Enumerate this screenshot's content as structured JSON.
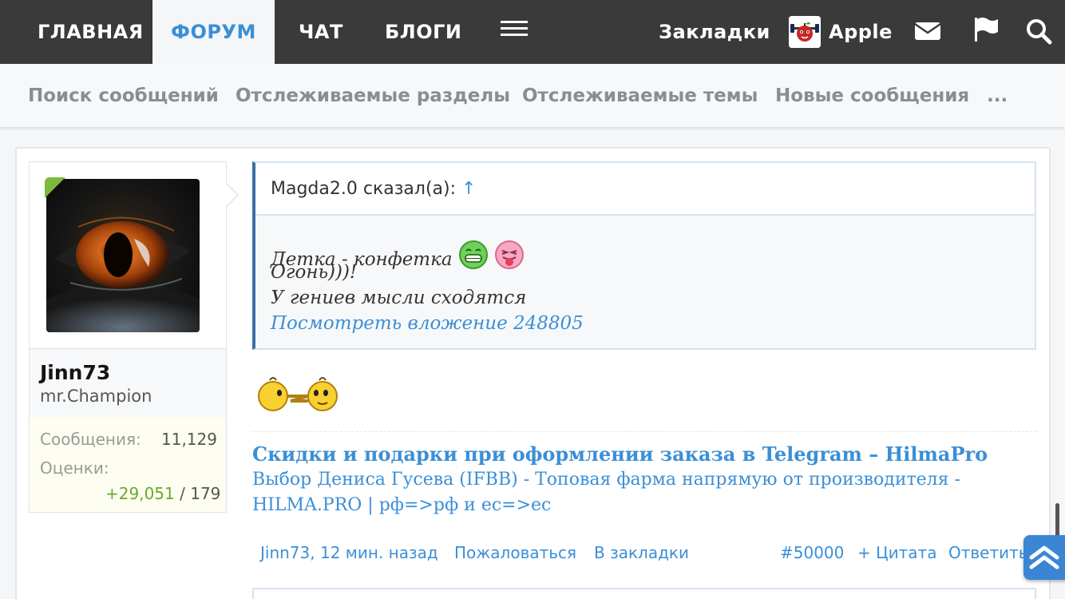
{
  "topnav": {
    "home": "ГЛАВНАЯ",
    "forum": "ФОРУМ",
    "chat": "ЧАТ",
    "blogs": "БЛОГИ",
    "bookmarks": "Закладки",
    "username": "Apple",
    "icons": [
      "menu-icon",
      "mail-icon",
      "flag-icon",
      "search-icon"
    ]
  },
  "subnav": {
    "search": "Поиск сообщений",
    "watched_forums": "Отслеживаемые разделы",
    "watched_threads": "Отслеживаемые темы",
    "new_posts": "Новые сообщения",
    "more": "..."
  },
  "user": {
    "name": "Jinn73",
    "title": "mr.Champion",
    "messages_label": "Сообщения:",
    "messages": "11,129",
    "ratings_label": "Оценки:",
    "ratings_positive": "+29,051",
    "ratings_sep": "/",
    "ratings_total": "179"
  },
  "quote": {
    "author": "Magda2.0 сказал(а):",
    "arrow": "↑",
    "line1": "Детка - конфетка",
    "line2": "Огонь)))!",
    "line3": "У гениев мысли сходятся",
    "attachment": "Посмотреть вложение 248805"
  },
  "signature": {
    "title": "Скидки и подарки при оформлении заказа в Telegram – HilmaPro",
    "line1": "Выбор Дениса Гусева (IFBB) - Топовая фарма напрямую от производителя -",
    "line2": "HILMA.PRO | рф=>рф и ес=>ес"
  },
  "footer": {
    "author_time": "Jinn73, 12 мин. назад",
    "report": "Пожаловаться",
    "bookmark": "В закладки",
    "post_number": "#50000",
    "quote": "+ Цитата",
    "reply": "Ответить"
  },
  "colors": {
    "nav_bg": "#3a3a3a",
    "accent": "#3b8fd6",
    "online": "#7cba3b",
    "positive": "#6aaa2a"
  }
}
